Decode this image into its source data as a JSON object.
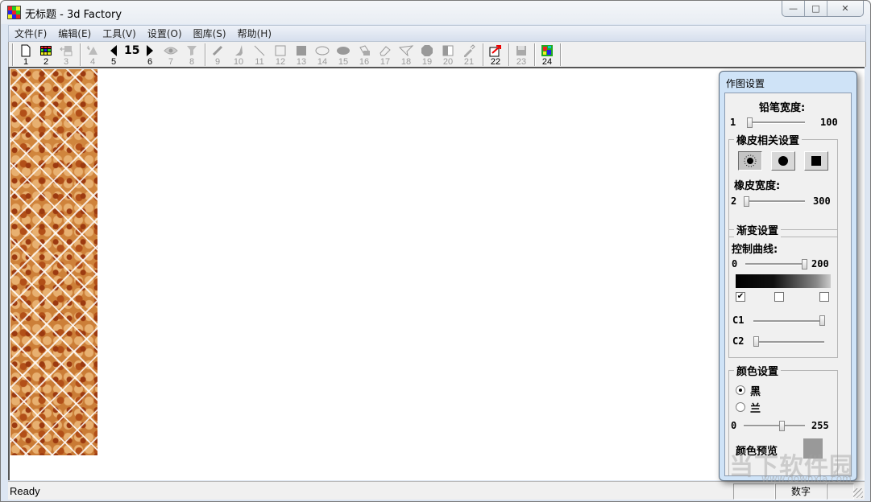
{
  "window": {
    "title": "无标题 - 3d Factory",
    "controls": {
      "minimize": "—",
      "maximize": "□",
      "close": "✕"
    }
  },
  "menu": [
    {
      "label": "文件(F)"
    },
    {
      "label": "编辑(E)"
    },
    {
      "label": "工具(V)"
    },
    {
      "label": "设置(O)"
    },
    {
      "label": "图库(S)"
    },
    {
      "label": "帮助(H)"
    }
  ],
  "toolbar": {
    "buttons": [
      {
        "num": "1",
        "icon": "new-file-icon",
        "enabled": true
      },
      {
        "num": "2",
        "icon": "grid-color-icon",
        "enabled": true
      },
      {
        "num": "3",
        "icon": "texture-apply-icon",
        "enabled": false
      },
      {
        "num": "4",
        "icon": "spray-icon",
        "enabled": false
      },
      {
        "num": "5",
        "icon": "prev-icon",
        "enabled": true
      },
      {
        "num": "6",
        "icon": "next-icon",
        "enabled": true
      },
      {
        "num": "7",
        "icon": "eye-icon",
        "enabled": false
      },
      {
        "num": "8",
        "icon": "filter-icon",
        "enabled": false
      },
      {
        "num": "9",
        "icon": "pencil-icon",
        "enabled": false
      },
      {
        "num": "10",
        "icon": "brush-icon",
        "enabled": false
      },
      {
        "num": "11",
        "icon": "line-icon",
        "enabled": false
      },
      {
        "num": "12",
        "icon": "rectangle-icon",
        "enabled": false
      },
      {
        "num": "13",
        "icon": "filled-rectangle-icon",
        "enabled": false
      },
      {
        "num": "14",
        "icon": "ellipse-icon",
        "enabled": false
      },
      {
        "num": "15",
        "icon": "filled-ellipse-icon",
        "enabled": false
      },
      {
        "num": "16",
        "icon": "fill-bucket-icon",
        "enabled": false
      },
      {
        "num": "17",
        "icon": "eraser-icon",
        "enabled": false
      },
      {
        "num": "18",
        "icon": "polygon-icon",
        "enabled": false
      },
      {
        "num": "19",
        "icon": "filled-polygon-icon",
        "enabled": false
      },
      {
        "num": "20",
        "icon": "gradient-icon",
        "enabled": false
      },
      {
        "num": "21",
        "icon": "eyedropper-icon",
        "enabled": false
      },
      {
        "num": "22",
        "icon": "undo-arrow-icon",
        "enabled": true
      },
      {
        "num": "23",
        "icon": "save-icon",
        "enabled": false
      },
      {
        "num": "24",
        "icon": "palette-image-icon",
        "enabled": true
      }
    ],
    "page_value": "15"
  },
  "statusbar": {
    "text": "Ready",
    "panes": [
      "",
      "数字",
      ""
    ]
  },
  "panel": {
    "title": "作图设置",
    "pencil": {
      "label": "铅笔宽度:",
      "min": "1",
      "max": "100",
      "value": 1
    },
    "eraser_group": {
      "title": "橡皮相关设置",
      "shapes": [
        {
          "name": "soft",
          "pressed": true
        },
        {
          "name": "circle",
          "pressed": false
        },
        {
          "name": "square",
          "pressed": false
        }
      ],
      "width_label": "橡皮宽度:",
      "min": "2",
      "max": "300",
      "value": 2
    },
    "gradient_group": {
      "title": "渐变设置",
      "curve_label": "控制曲线:",
      "min": "0",
      "max": "200",
      "value": 200,
      "checkboxes": [
        true,
        false,
        false
      ],
      "c1_label": "C1",
      "c1_value": 1.0,
      "c2_label": "C2",
      "c2_value": 0.0
    },
    "color_group": {
      "title": "颜色设置",
      "options": [
        {
          "label": "黑",
          "selected": true
        },
        {
          "label": "兰",
          "selected": false
        }
      ],
      "min": "0",
      "max": "255",
      "value": 160,
      "preview_label": "颜色预览",
      "preview_color": "#999999"
    }
  },
  "watermark": {
    "main": "当下软件园",
    "url": "www.downxia.com"
  }
}
